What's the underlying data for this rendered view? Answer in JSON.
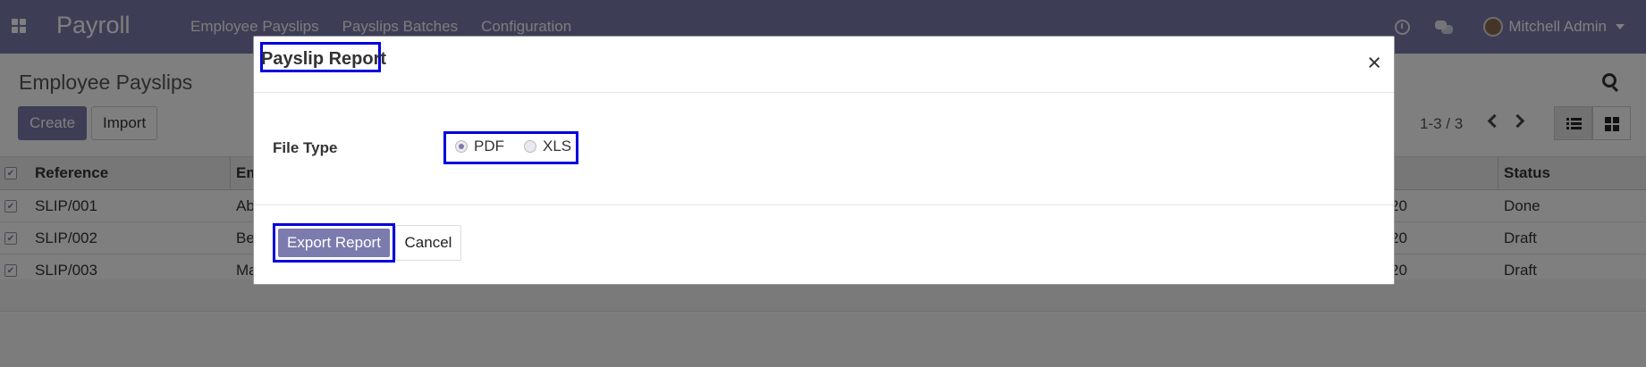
{
  "navbar": {
    "app_name": "Payroll",
    "menu": [
      "Employee Payslips",
      "Payslips Batches",
      "Configuration"
    ],
    "user_name": "Mitchell Admin",
    "icons": [
      "apps-icon",
      "clock-icon",
      "chat-icon",
      "caret-down-icon"
    ]
  },
  "control_panel": {
    "title": "Employee Payslips",
    "create_label": "Create",
    "import_label": "Import",
    "pager": "1-3 / 3",
    "views": [
      "list",
      "kanban"
    ],
    "active_view": "list"
  },
  "table": {
    "columns": [
      "Reference",
      "Em",
      "Status"
    ],
    "rows": [
      {
        "reference": "SLIP/001",
        "employee": "Ab",
        "date": "20",
        "status": "Done"
      },
      {
        "reference": "SLIP/002",
        "employee": "Be",
        "date": "20",
        "status": "Draft"
      },
      {
        "reference": "SLIP/003",
        "employee": "Ma",
        "date": "20",
        "status": "Draft"
      }
    ]
  },
  "dialog": {
    "title": "Payslip Report",
    "close_glyph": "×",
    "field_label": "File Type",
    "options": [
      {
        "label": "PDF",
        "checked": true
      },
      {
        "label": "XLS",
        "checked": false
      }
    ],
    "export_label": "Export Report",
    "cancel_label": "Cancel"
  },
  "colors": {
    "brand": "#7c7bad",
    "highlight": "#0000dd"
  }
}
